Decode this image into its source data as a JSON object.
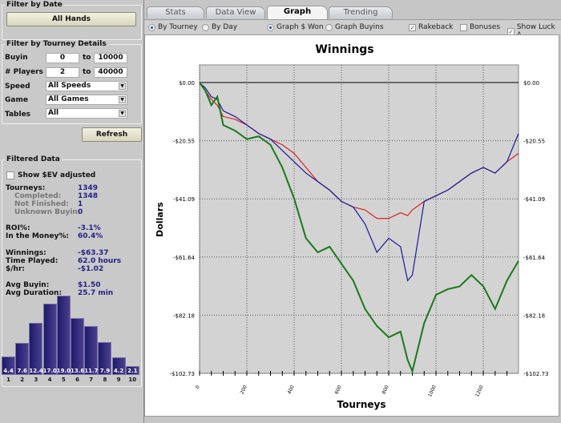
{
  "filter_date": {
    "title": "Filter by Date",
    "button": "All Hands"
  },
  "filter_tourney": {
    "title": "Filter by Tourney Details",
    "buyin": {
      "label": "Buyin",
      "from": "0",
      "to_label": "to",
      "to": "10000"
    },
    "players": {
      "label": "# Players",
      "from": "2",
      "to_label": "to",
      "to": "40000"
    },
    "speed": {
      "label": "Speed",
      "value": "All Speeds"
    },
    "game": {
      "label": "Game",
      "value": "All Games"
    },
    "tables": {
      "label": "Tables",
      "value": "All"
    },
    "refresh": "Refresh"
  },
  "filtered": {
    "title": "Filtered Data",
    "ev_label": "Show $EV adjusted",
    "stats": [
      {
        "label": "Tourneys:",
        "value": "1349",
        "sub": false
      },
      {
        "label": "Completed:",
        "value": "1348",
        "sub": true
      },
      {
        "label": "Not Finished:",
        "value": "1",
        "sub": true
      },
      {
        "label": "Unknown Buyin:",
        "value": "0",
        "sub": true
      },
      {
        "label": "ROI%:",
        "value": "-3.1%",
        "sub": false
      },
      {
        "label": "In the Money%:",
        "value": "60.4%",
        "sub": false
      },
      {
        "label": "Winnings:",
        "value": "-$63.37",
        "sub": false
      },
      {
        "label": "Time Played:",
        "value": "62.0 hours",
        "sub": false
      },
      {
        "label": "$/hr:",
        "value": "-$1.02",
        "sub": false
      },
      {
        "label": "Avg Buyin:",
        "value": "$1.50",
        "sub": false
      },
      {
        "label": "Avg Duration:",
        "value": "25.7 min",
        "sub": false
      }
    ],
    "histogram": {
      "labels": [
        "1",
        "2",
        "3",
        "4",
        "5",
        "6",
        "7",
        "8",
        "9",
        "10"
      ],
      "values": [
        "4.4",
        "7.6",
        "12.4",
        "17.0",
        "19.0",
        "13.6",
        "11.7",
        "7.9",
        "4.2",
        "2.1"
      ]
    }
  },
  "tabs": [
    {
      "label": "Stats"
    },
    {
      "label": "Data View"
    },
    {
      "label": "Graph",
      "active": true
    },
    {
      "label": "Trending"
    }
  ],
  "options": {
    "by_tourney": "By Tourney",
    "by_day": "By Day",
    "graph_won": "Graph $ Won",
    "graph_buyins": "Graph Buyins",
    "rakeback": "Rakeback",
    "bonuses": "Bonuses",
    "show_luck": "Show Luck A"
  },
  "chart_data": {
    "type": "line",
    "title": "Winnings",
    "xlabel": "Tourneys",
    "ylabel": "Dollars",
    "xlim": [
      0,
      1349
    ],
    "ylim": [
      -102.73,
      5
    ],
    "xticks": [
      "0",
      "200",
      "400",
      "600",
      "800",
      "1000",
      "1200"
    ],
    "yticks": [
      "$0.00",
      "-$20.55",
      "-$41.09",
      "-$61.64",
      "-$82.18",
      "-$102.73"
    ],
    "ytick_values": [
      0,
      -20.55,
      -41.09,
      -61.64,
      -82.18,
      -102.73
    ],
    "x": [
      0,
      25,
      50,
      75,
      100,
      150,
      200,
      250,
      300,
      350,
      400,
      450,
      500,
      550,
      600,
      650,
      700,
      750,
      800,
      850,
      880,
      900,
      950,
      1000,
      1050,
      1100,
      1150,
      1200,
      1250,
      1300,
      1349
    ],
    "series": [
      {
        "name": "Winnings",
        "color": "#1a7a1a",
        "values": [
          0,
          -3,
          -8,
          -5,
          -15,
          -17,
          -20,
          -19,
          -22,
          -30,
          -41,
          -55,
          -60,
          -58,
          -64,
          -70,
          -80,
          -86,
          -90,
          -88,
          -98,
          -102,
          -85,
          -75,
          -73,
          -72,
          -68,
          -72,
          -80,
          -70,
          -63
        ]
      },
      {
        "name": "Blue",
        "color": "#1a1a9a",
        "values": [
          0,
          -2,
          -5,
          -6,
          -10,
          -12,
          -15,
          -18,
          -20,
          -24,
          -28,
          -32,
          -35,
          -38,
          -42,
          -44,
          -50,
          -60,
          -55,
          -58,
          -70,
          -68,
          -42,
          -40,
          -38,
          -35,
          -32,
          -30,
          -32,
          -28,
          -18
        ]
      },
      {
        "name": "Red",
        "color": "#e02020",
        "values": [
          0,
          -3,
          -6,
          -8,
          -12,
          -13,
          -15,
          -18,
          -20,
          -22,
          -25,
          -30,
          -35,
          -38,
          -42,
          -44,
          -45,
          -48,
          -48,
          -46,
          -47,
          -45,
          -42,
          -40,
          -38,
          -35,
          -32,
          -30,
          -32,
          -28,
          -25
        ]
      }
    ]
  }
}
